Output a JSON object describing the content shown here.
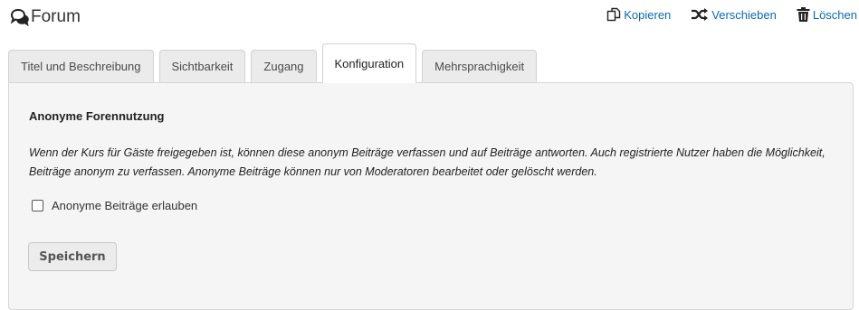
{
  "header": {
    "title": "Forum",
    "title_icon": "forum-icon",
    "actions": [
      {
        "label": "Kopieren",
        "icon": "copy-icon"
      },
      {
        "label": "Verschieben",
        "icon": "shuffle-icon"
      },
      {
        "label": "Löschen",
        "icon": "trash-icon"
      }
    ]
  },
  "tabs": [
    {
      "label": "Titel und Beschreibung"
    },
    {
      "label": "Sichtbarkeit"
    },
    {
      "label": "Zugang"
    },
    {
      "label": "Konfiguration",
      "active": true
    },
    {
      "label": "Mehrsprachigkeit"
    }
  ],
  "panel": {
    "section_title": "Anonyme Forennutzung",
    "description": "Wenn der Kurs für Gäste freigegeben ist, können diese anonym Beiträge verfassen und auf Beiträge antworten. Auch registrierte Nutzer haben die Möglichkeit, Beiträge anonym zu verfassen. Anonyme Beiträge können nur von Moderatoren bearbeitet oder gelöscht werden.",
    "checkbox_label": "Anonyme Beiträge erlauben",
    "checkbox_checked": false,
    "save_label": "Speichern"
  },
  "colors": {
    "link": "#0a6ab5",
    "panel_bg": "#f5f5f5",
    "tab_bg": "#ebebeb"
  }
}
